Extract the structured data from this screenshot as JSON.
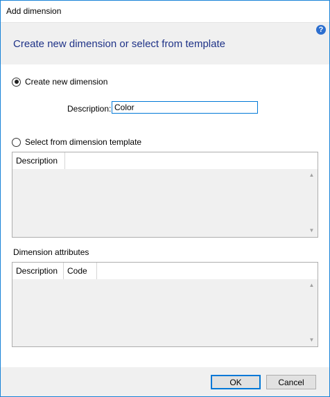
{
  "window": {
    "title": "Add dimension"
  },
  "header": {
    "heading": "Create new dimension or select from template",
    "help_icon": "help-icon",
    "help_glyph": "?"
  },
  "create_new": {
    "label": "Create new dimension",
    "checked": true,
    "description_label": "Description:",
    "description_value": "Color"
  },
  "template": {
    "label": "Select from dimension template",
    "checked": false,
    "columns": [
      "Description"
    ],
    "rows": []
  },
  "attributes": {
    "label": "Dimension attributes",
    "columns": [
      "Description",
      "Code"
    ],
    "rows": []
  },
  "scroll": {
    "up": "▲",
    "down": "▼"
  },
  "buttons": {
    "ok": "OK",
    "cancel": "Cancel"
  },
  "colors": {
    "accent": "#1883d7",
    "heading": "#1e3287",
    "panel": "#f0f0f0"
  }
}
